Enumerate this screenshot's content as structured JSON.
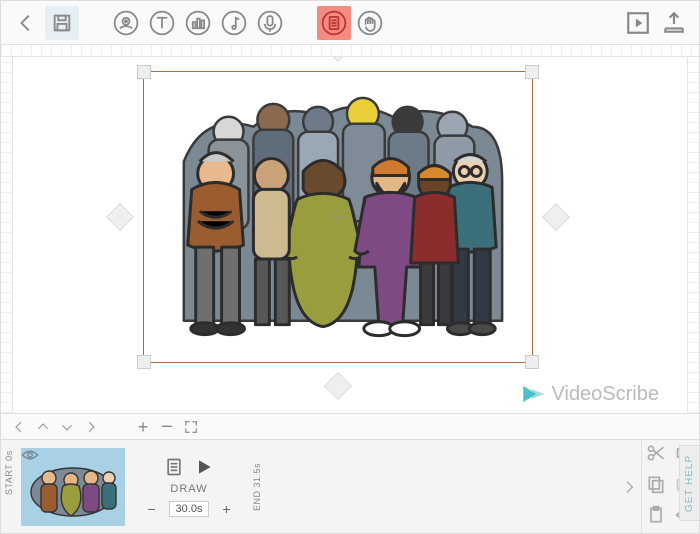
{
  "toolbar": {
    "back": "Back",
    "save": "Save",
    "insert_image": "Insert image",
    "insert_text": "Insert text",
    "insert_chart": "Insert chart",
    "insert_music": "Insert music",
    "record_voice": "Record voiceover",
    "properties": "Element properties",
    "hand": "Hand tool",
    "preview": "Preview",
    "export": "Publish / Export"
  },
  "canvas": {
    "selected_element": "crowd-illustration"
  },
  "brand": {
    "name": "VideoScribe"
  },
  "viewbar": {
    "zoom_in": "+",
    "zoom_out": "−",
    "fullscreen": "⤢"
  },
  "timeline": {
    "start_label": "START",
    "start_time": "0s",
    "end_label": "END",
    "end_time": "31.5s",
    "action": "DRAW",
    "duration": "30.0s",
    "next": "Next",
    "tools": {
      "cut": "Cut",
      "camera": "Set camera",
      "copy": "Copy",
      "camera_locked": "Camera locked",
      "paste": "Paste",
      "visible": "Visible"
    }
  },
  "help": {
    "label": "GET HELP"
  }
}
